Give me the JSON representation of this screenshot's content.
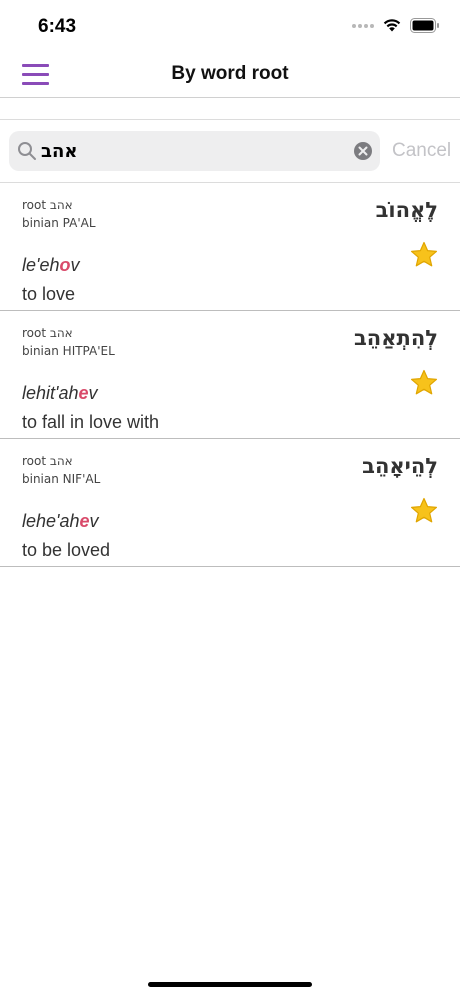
{
  "status_bar": {
    "time": "6:43"
  },
  "nav": {
    "title": "By word root"
  },
  "search": {
    "value": "אהב",
    "cancel_label": "Cancel"
  },
  "colors": {
    "accent": "#8a4bb8",
    "highlight": "#d94a6a",
    "star": "#f7c21b"
  },
  "entries": [
    {
      "root": "root אהב",
      "binian": "binian PA'AL",
      "hebrew": "לֶאֱהוֹב",
      "translit_before": "le'eh",
      "translit_accent": "o",
      "translit_after": "v",
      "meaning": "to love",
      "favorite_icon": "star-icon"
    },
    {
      "root": "root אהב",
      "binian": "binian HITPA'EL",
      "hebrew": "לְהִתְאַהֵב",
      "translit_before": "lehit'ah",
      "translit_accent": "e",
      "translit_after": "v",
      "meaning": "to fall in love with",
      "favorite_icon": "star-icon"
    },
    {
      "root": "root אהב",
      "binian": "binian NIF'AL",
      "hebrew": "לְהֵיאָהֵב",
      "translit_before": "lehe'ah",
      "translit_accent": "e",
      "translit_after": "v",
      "meaning": "to be loved",
      "favorite_icon": "star-icon"
    }
  ]
}
